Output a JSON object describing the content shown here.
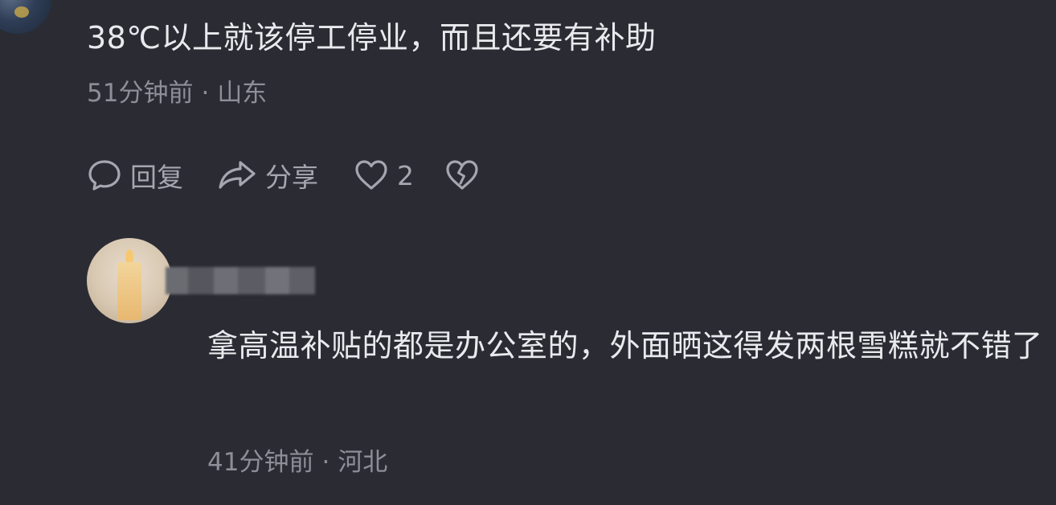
{
  "comment_top": {
    "text": "38℃以上就该停工停业，而且还要有补助",
    "time": "51分钟前",
    "separator": "·",
    "location": "山东"
  },
  "actions": {
    "reply_label": "回复",
    "share_label": "分享",
    "like_count": "2",
    "reply_icon": "speech-bubble-icon",
    "share_icon": "share-arrow-icon",
    "like_icon": "heart-icon",
    "dislike_icon": "broken-heart-icon"
  },
  "reply": {
    "username_hidden": "blurred-username",
    "text": "拿高温补贴的都是办公室的，外面晒这得发两根雪糕就不错了",
    "time": "41分钟前",
    "separator": "·",
    "location": "河北"
  },
  "colors": {
    "background": "#2b2b33",
    "text_primary": "#e9e9ee",
    "text_secondary": "#8e8e98",
    "icon": "#a6a6b0"
  }
}
